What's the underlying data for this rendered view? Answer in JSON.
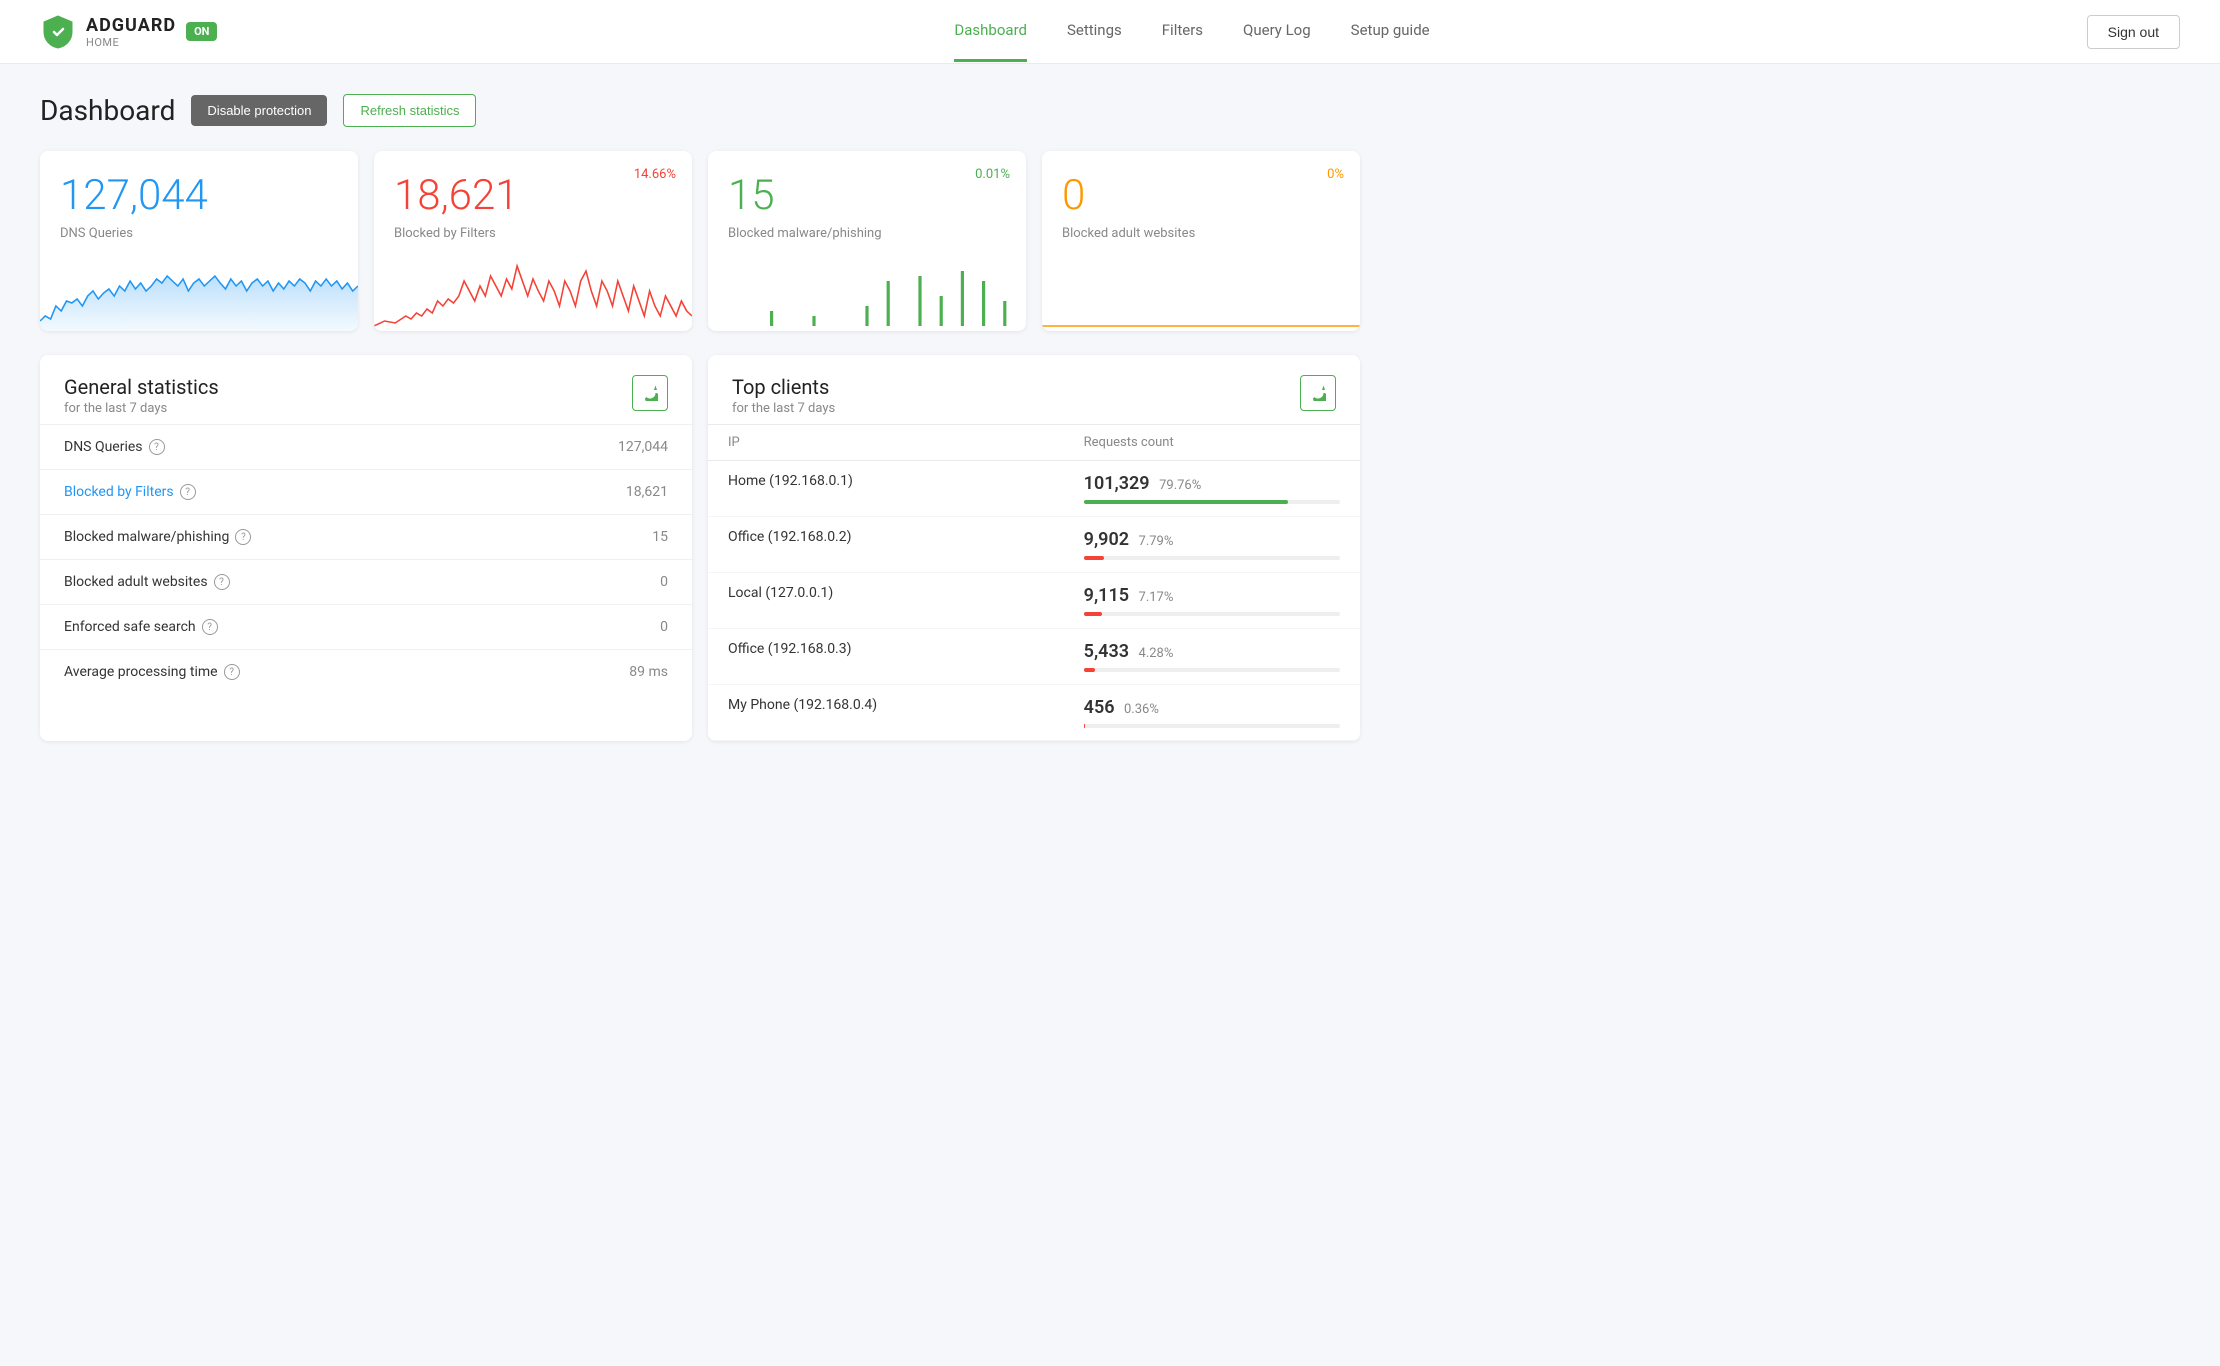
{
  "brand": {
    "name": "ADGUARD",
    "sub": "HOME",
    "badge": "ON"
  },
  "nav": {
    "links": [
      "Dashboard",
      "Settings",
      "Filters",
      "Query Log",
      "Setup guide"
    ],
    "active": "Dashboard",
    "sign_out": "Sign out"
  },
  "header": {
    "title": "Dashboard",
    "disable_btn": "Disable protection",
    "refresh_btn": "Refresh statistics"
  },
  "stat_cards": [
    {
      "id": "dns",
      "number": "127,044",
      "label": "DNS Queries",
      "percentage": null,
      "color": "#2196f3",
      "pct_color": "#4caf50"
    },
    {
      "id": "blocked",
      "number": "18,621",
      "label": "Blocked by Filters",
      "percentage": "14.66%",
      "color": "#f44336",
      "pct_color": "#f44336"
    },
    {
      "id": "malware",
      "number": "15",
      "label": "Blocked malware/phishing",
      "percentage": "0.01%",
      "color": "#4caf50",
      "pct_color": "#4caf50"
    },
    {
      "id": "adult",
      "number": "0",
      "label": "Blocked adult websites",
      "percentage": "0%",
      "color": "#ff9800",
      "pct_color": "#ff9800"
    }
  ],
  "general_stats": {
    "title": "General statistics",
    "subtitle": "for the last 7 days",
    "rows": [
      {
        "label": "DNS Queries",
        "value": "127,044",
        "blue": false
      },
      {
        "label": "Blocked by Filters",
        "value": "18,621",
        "blue": true
      },
      {
        "label": "Blocked malware/phishing",
        "value": "15",
        "blue": false
      },
      {
        "label": "Blocked adult websites",
        "value": "0",
        "blue": false
      },
      {
        "label": "Enforced safe search",
        "value": "0",
        "blue": false
      },
      {
        "label": "Average processing time",
        "value": "89 ms",
        "blue": false
      }
    ]
  },
  "top_clients": {
    "title": "Top clients",
    "subtitle": "for the last 7 days",
    "col_ip": "IP",
    "col_requests": "Requests count",
    "rows": [
      {
        "name": "Home (192.168.0.1)",
        "count": "101,329",
        "pct": "79.76%",
        "bar": 79.76,
        "bar_color": "green"
      },
      {
        "name": "Office (192.168.0.2)",
        "count": "9,902",
        "pct": "7.79%",
        "bar": 7.79,
        "bar_color": "red"
      },
      {
        "name": "Local (127.0.0.1)",
        "count": "9,115",
        "pct": "7.17%",
        "bar": 7.17,
        "bar_color": "red"
      },
      {
        "name": "Office (192.168.0.3)",
        "count": "5,433",
        "pct": "4.28%",
        "bar": 4.28,
        "bar_color": "red"
      },
      {
        "name": "My Phone (192.168.0.4)",
        "count": "456",
        "pct": "0.36%",
        "bar": 0.36,
        "bar_color": "red"
      }
    ]
  },
  "colors": {
    "accent_green": "#4caf50",
    "accent_blue": "#2196f3",
    "accent_red": "#f44336",
    "accent_orange": "#ff9800"
  }
}
